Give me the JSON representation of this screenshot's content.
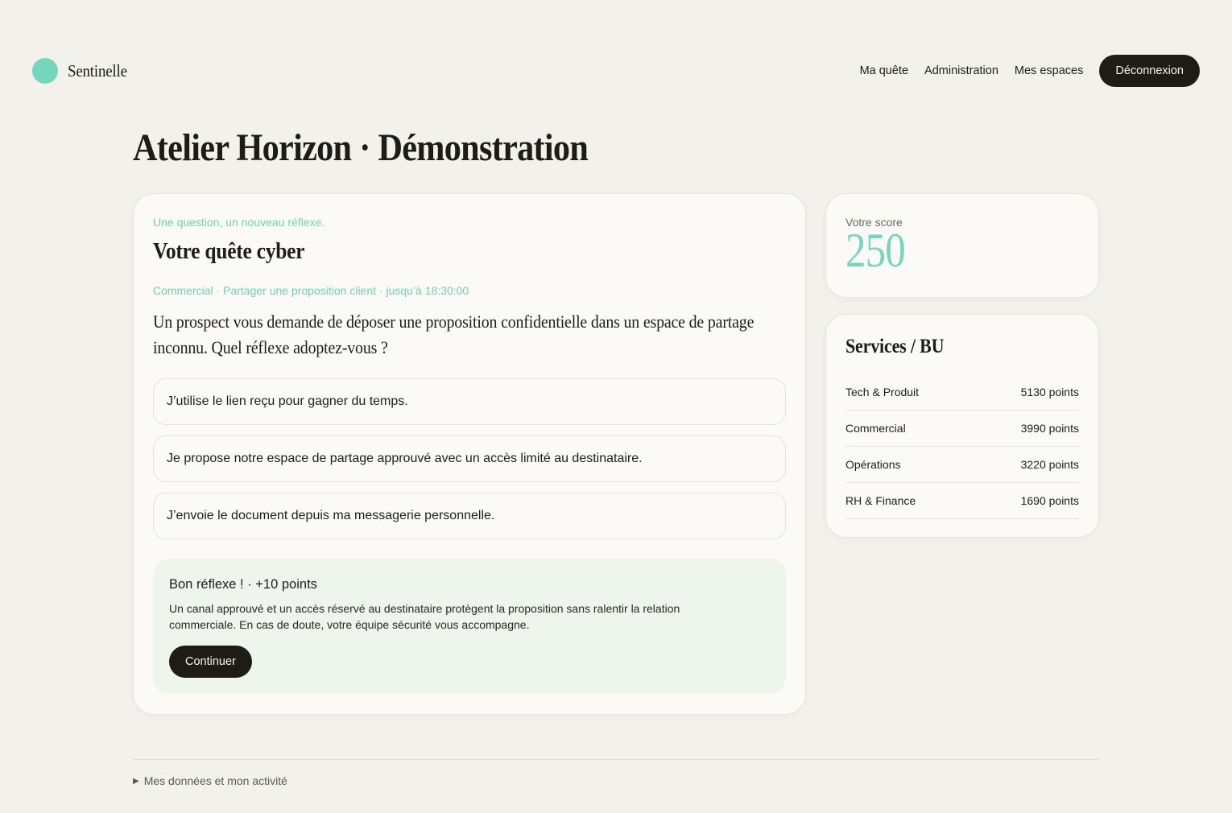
{
  "brand": {
    "name": "Sentinelle",
    "color": "#74d7bd"
  },
  "nav": {
    "links": [
      "Ma quête",
      "Administration",
      "Mes espaces"
    ],
    "logout_label": "Déconnexion"
  },
  "page": {
    "title": "Atelier Horizon · Démonstration"
  },
  "quest": {
    "eyebrow": "Une question, un nouveau réflexe.",
    "title": "Votre quête cyber",
    "meta": "Commercial · Partager une proposition client · jusqu’à 18:30:00",
    "question": "Un prospect vous demande de déposer une proposition confidentielle dans un espace de partage inconnu. Quel réflexe adoptez-vous ?",
    "options": [
      "J’utilise le lien reçu pour gagner du temps.",
      "Je propose notre espace de partage approuvé avec un accès limité au destinataire.",
      "J’envoie le document depuis ma messagerie personnelle."
    ],
    "feedback": {
      "title": "Bon réflexe ! · +10 points",
      "text": "Un canal approuvé et un accès réservé au destinataire protègent la proposition sans ralentir la relation commerciale. En cas de doute, votre équipe sécurité vous accompagne.",
      "button": "Continuer"
    }
  },
  "score": {
    "label": "Votre score",
    "value": "250"
  },
  "bu": {
    "title": "Services / BU",
    "rows": [
      {
        "name": "Tech & Produit",
        "points": "5130 points"
      },
      {
        "name": "Commercial",
        "points": "3990 points"
      },
      {
        "name": "Opérations",
        "points": "3220 points"
      },
      {
        "name": "RH & Finance",
        "points": "1690 points"
      }
    ]
  },
  "footer": {
    "toggle_icon": "triangle-right-icon",
    "toggle_label": "Mes données et mon activité"
  }
}
